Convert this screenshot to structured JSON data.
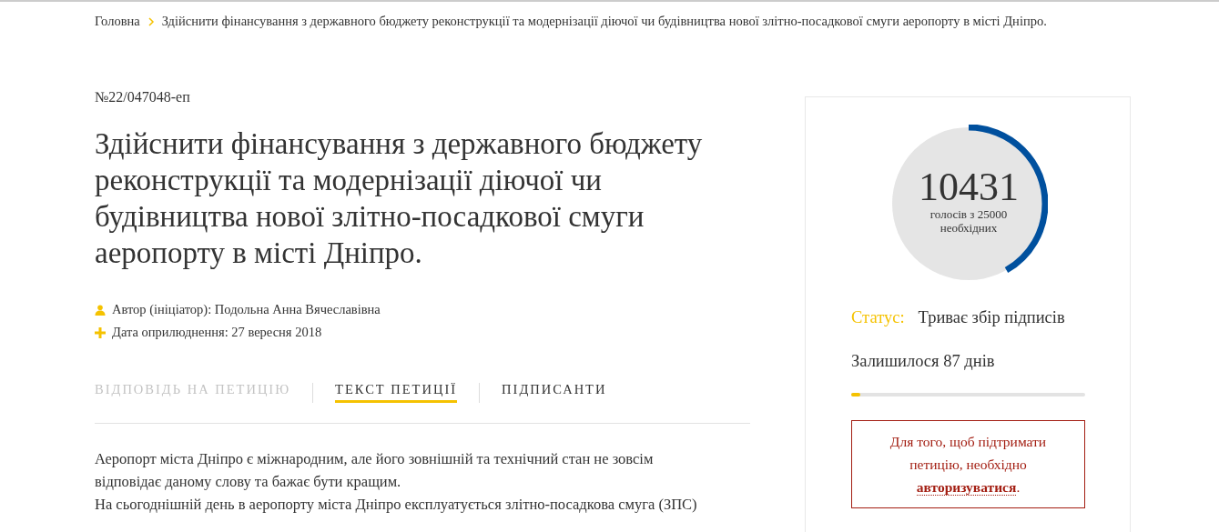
{
  "breadcrumb": [
    {
      "label": "Головна"
    },
    {
      "label": "Здійснити фінансування з державного бюджету реконструкції та модернізації діючої чи будівництва нової злітно-посадкової смуги аеропорту в місті Дніпро."
    }
  ],
  "petition": {
    "number": "№22/047048-еп",
    "title": "Здійснити фінансування з державного бюджету реконструкції та модернізації діючої чи будівництва нової злітно-посадкової смуги аеропорту в місті Дніпро.",
    "meta": [
      {
        "kind": "author",
        "text": "Автор (ініціатор): Подольна Анна Вячеславівна"
      },
      {
        "kind": "date",
        "text": "Дата оприлюднення: 27 вересня 2018"
      }
    ],
    "tabs": [
      {
        "label": "ВІДПОВІДЬ НА ПЕТИЦІЮ",
        "selected": false,
        "disabled": true
      },
      {
        "label": "ТЕКСТ ПЕТИЦІЇ",
        "selected": true,
        "disabled": false
      },
      {
        "label": "ПІДПИСАНТИ",
        "selected": false,
        "disabled": false
      }
    ],
    "body": [
      "Аеропорт міста Дніпро є міжнародним, але його зовнішній та технічний стан не зовсім відповідає даному слову та бажає бути кращим.",
      "На сьогоднішній день в аеропорту міста Дніпро експлуатується злітно-посадкова смуга (ЗПС)"
    ]
  },
  "votes": {
    "count": "10431",
    "caption": "голосів з 25000 необхідних",
    "level": 0.417
  },
  "status": {
    "label": "Статус:",
    "value": "Триває збір підписів"
  },
  "remaining": {
    "text": "Залишилося 87 днів",
    "level": 0.04
  },
  "auth_notice": {
    "text": "Для того, щоб підтримати петицію, необхідно",
    "link": "авторизуватися",
    "suffix": "."
  }
}
